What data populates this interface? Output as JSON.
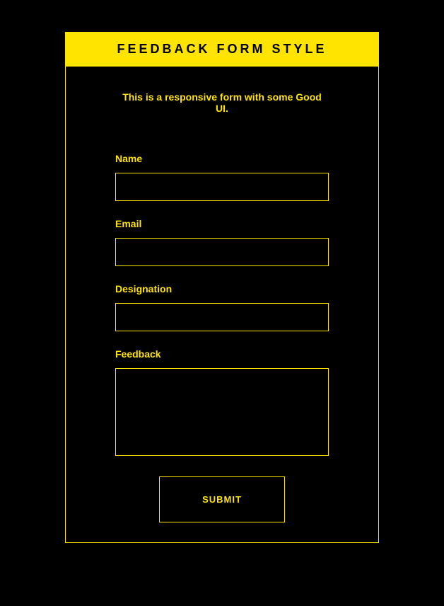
{
  "header": {
    "title": "FEEDBACK FORM STYLE"
  },
  "content": {
    "subtitle": "This is a responsive form with some Good UI."
  },
  "form": {
    "fields": {
      "name": {
        "label": "Name",
        "value": ""
      },
      "email": {
        "label": "Email",
        "value": ""
      },
      "designation": {
        "label": "Designation",
        "value": ""
      },
      "feedback": {
        "label": "Feedback",
        "value": ""
      }
    },
    "submit_label": "SUBMIT"
  },
  "colors": {
    "background": "#000000",
    "accent": "#ffe400"
  }
}
